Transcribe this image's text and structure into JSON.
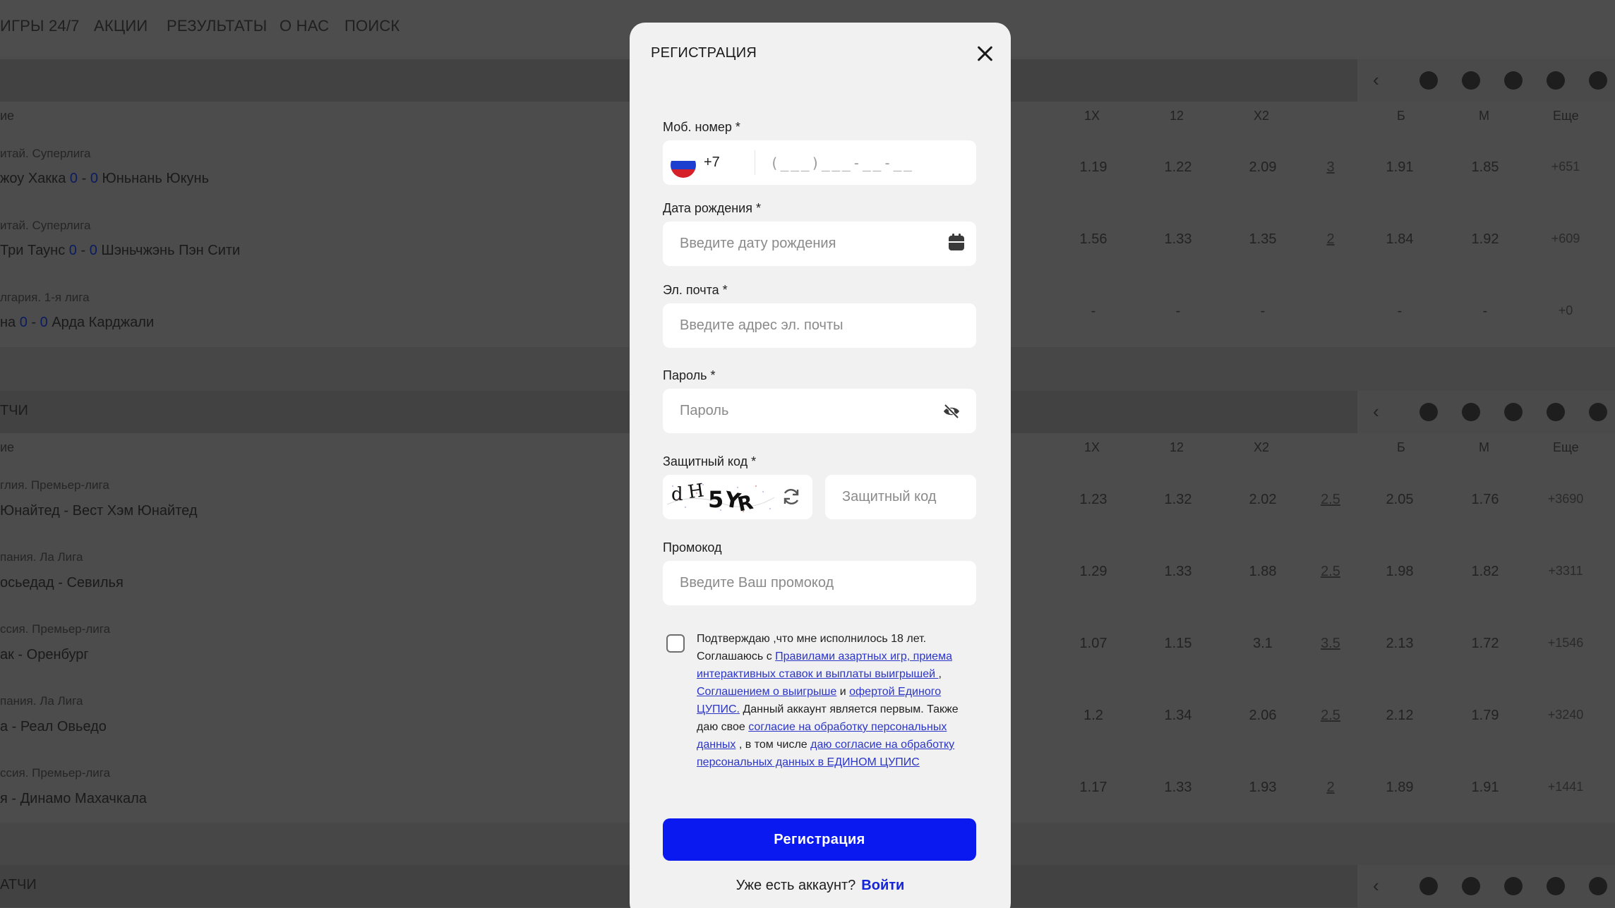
{
  "nav": {
    "items": [
      "ИГРЫ 24/7",
      "АКЦИИ",
      "РЕЗУЛЬТАТЫ",
      "О НАС",
      "ПОИСК"
    ]
  },
  "sections": [
    {
      "title": "",
      "headers": [
        "ие",
        "1X",
        "12",
        "X2",
        "Б",
        "М",
        "Еще"
      ],
      "matches": [
        {
          "league": "итай. Суперлига",
          "home": "жоу Хакка",
          "score_home": "0",
          "score_away": "0",
          "away": "Юньнань Юкунь",
          "odds": [
            "1.19",
            "1.22",
            "2.09"
          ],
          "total": "3",
          "b": "1.91",
          "m": "1.85",
          "more": "+651"
        },
        {
          "league": "итай. Суперлига",
          "home": "Три Таунс",
          "score_home": "0",
          "score_away": "0",
          "away": "Шэньчжэнь Пэн Сити",
          "odds": [
            "1.56",
            "1.33",
            "1.35"
          ],
          "total": "2",
          "b": "1.84",
          "m": "1.92",
          "more": "+609"
        },
        {
          "league": "лгария. 1-я лига",
          "home": "на",
          "score_home": "0",
          "score_away": "0",
          "away": "Арда Карджали",
          "odds": [
            "-",
            "-",
            "-"
          ],
          "total": "",
          "b": "-",
          "m": "-",
          "more": "+0"
        }
      ]
    },
    {
      "title": "ТЧИ",
      "headers": [
        "ие",
        "1X",
        "12",
        "X2",
        "Б",
        "М",
        "Еще"
      ],
      "matches": [
        {
          "league": "глия. Премьер-лига",
          "home": "Юнайтед",
          "away": "Вест Хэм Юнайтед",
          "odds": [
            "1.23",
            "1.32",
            "2.02"
          ],
          "total": "2.5",
          "b": "2.05",
          "m": "1.76",
          "more": "+3690"
        },
        {
          "league": "пания. Ла Лига",
          "home": "осьедад",
          "away": "Севилья",
          "odds": [
            "1.29",
            "1.33",
            "1.88"
          ],
          "total": "2.5",
          "b": "1.98",
          "m": "1.82",
          "more": "+3311"
        },
        {
          "league": "ссия. Премьер-лига",
          "home": "ак",
          "away": "Оренбург",
          "odds": [
            "1.07",
            "1.15",
            "3.1"
          ],
          "total": "3.5",
          "b": "2.13",
          "m": "1.72",
          "more": "+1546"
        },
        {
          "league": "пания. Ла Лига",
          "home": "а",
          "away": "Реал Овьедо",
          "odds": [
            "1.2",
            "1.34",
            "2.06"
          ],
          "total": "2.5",
          "b": "2.12",
          "m": "1.79",
          "more": "+3240"
        },
        {
          "league": "ссия. Премьер-лига",
          "home": "я",
          "away": "Динамо Махачкала",
          "odds": [
            "1.17",
            "1.33",
            "1.93"
          ],
          "total": "2",
          "b": "1.89",
          "m": "1.91",
          "more": "+1441"
        }
      ]
    },
    {
      "title": "АТЧИ"
    }
  ],
  "modal": {
    "title": "РЕГИСТРАЦИЯ",
    "phone": {
      "label": "Моб. номер *",
      "dial_code": "+7",
      "mask": "(___)___-__-__"
    },
    "birthdate": {
      "label": "Дата рождения *",
      "placeholder": "Введите дату рождения"
    },
    "email": {
      "label": "Эл. почта *",
      "placeholder": "Введите адрес эл. почты"
    },
    "password": {
      "label": "Пароль *",
      "placeholder": "Пароль"
    },
    "captcha": {
      "label": "Защитный код *",
      "image_text": "dH5YR",
      "placeholder": "Защитный код"
    },
    "promo": {
      "label": "Промокод",
      "placeholder": "Введите Ваш промокод"
    },
    "consent": {
      "text1": "Подтверждаю ,что мне исполнилось 18 лет. Соглашаюсь с ",
      "link1": "Правилами азартных игр, приема интерактивных ставок и выплаты выигрышей ",
      "text2": ", ",
      "link2": "Соглашением о выигрыше",
      "text3": " и ",
      "link3": "офертой Единого ЦУПИС.",
      "text4": " Данный аккаунт является первым. Также даю свое ",
      "link4": "согласие на обработку персональных данных",
      "text5": " , в том числе ",
      "link5": "даю согласие на обработку персональных данных в ЕДИНОМ ЦУПИС"
    },
    "submit_label": "Регистрация",
    "login_prompt": "Уже есть аккаунт?",
    "login_link": "Войти"
  },
  "colors": {
    "primary": "#0a19f0",
    "link": "#2b35c8",
    "modal_bg": "#f1f1f1",
    "overlay": "#4b4b4b"
  }
}
